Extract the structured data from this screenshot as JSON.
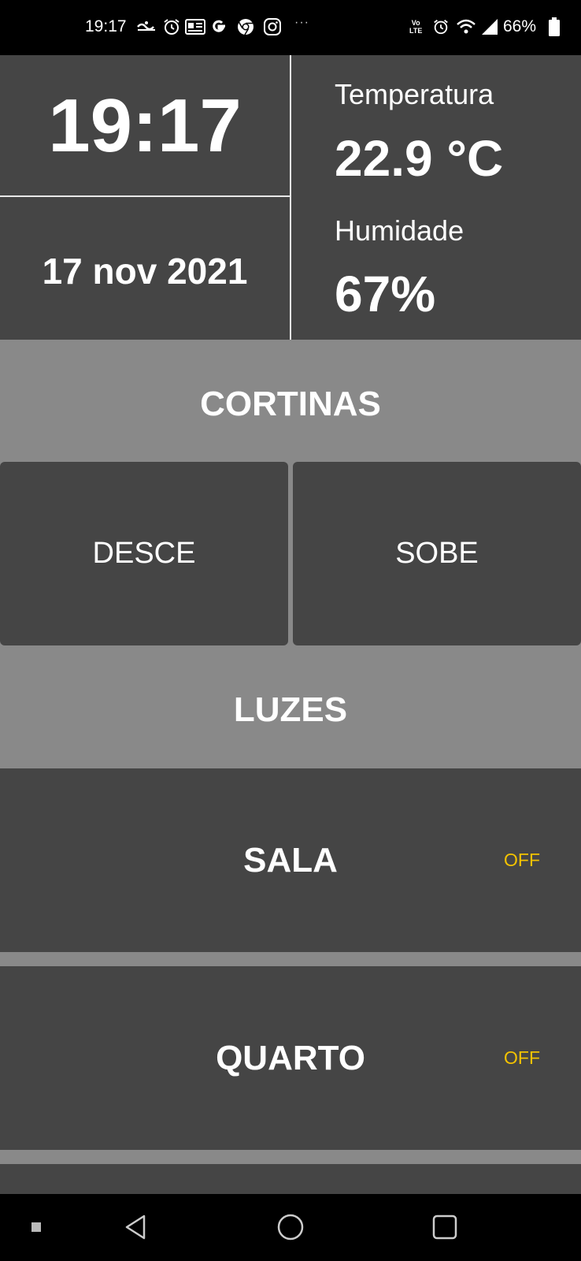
{
  "status_bar": {
    "time": "19:17",
    "battery_percent": "66%",
    "volte": "Vo LTE",
    "overflow": "···",
    "notification_icons": [
      "google-logo-icon",
      "alarm-icon",
      "news-icon",
      "google-g-icon",
      "chrome-icon",
      "instagram-icon"
    ],
    "system_icons": [
      "volte-icon",
      "alarm-icon",
      "wifi-icon",
      "signal-icon",
      "battery-icon"
    ]
  },
  "info": {
    "clock": "19:17",
    "date": "17 nov 2021",
    "temperature_label": "Temperatura",
    "temperature_value": "22.9 °C",
    "humidity_label": "Humidade",
    "humidity_value": "67%"
  },
  "cortinas": {
    "title": "CORTINAS",
    "down_label": "DESCE",
    "up_label": "SOBE"
  },
  "luzes": {
    "title": "LUZES",
    "items": [
      {
        "name": "SALA",
        "state": "OFF"
      },
      {
        "name": "QUARTO",
        "state": "OFF"
      }
    ]
  },
  "colors": {
    "panel_dark": "#454545",
    "panel_light": "#898989",
    "state_off": "#f2c200"
  },
  "nav_bar": {
    "icons": [
      "menu-square-icon",
      "back-icon",
      "home-icon",
      "recents-icon"
    ]
  }
}
